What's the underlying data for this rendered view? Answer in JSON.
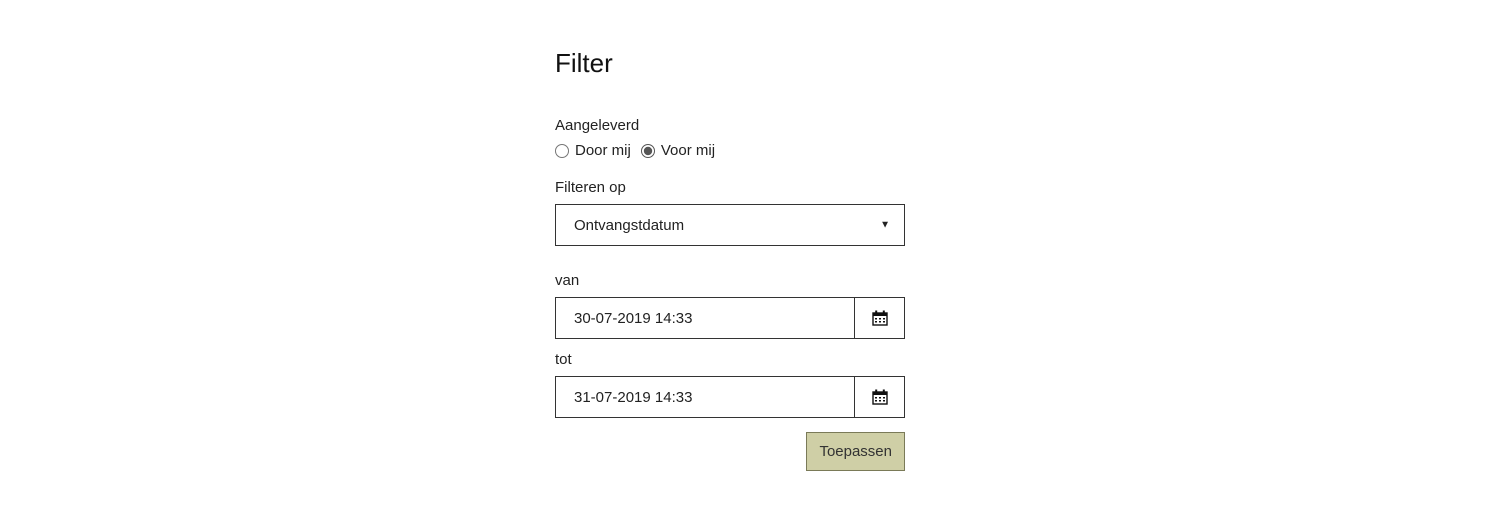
{
  "title": "Filter",
  "aangeleverd": {
    "label": "Aangeleverd",
    "options": {
      "door_mij": "Door mij",
      "voor_mij": "Voor mij"
    }
  },
  "filteren_op": {
    "label": "Filteren op",
    "selected": "Ontvangstdatum"
  },
  "van": {
    "label": "van",
    "value": "30-07-2019 14:33"
  },
  "tot": {
    "label": "tot",
    "value": "31-07-2019 14:33"
  },
  "submit_label": "Toepassen"
}
